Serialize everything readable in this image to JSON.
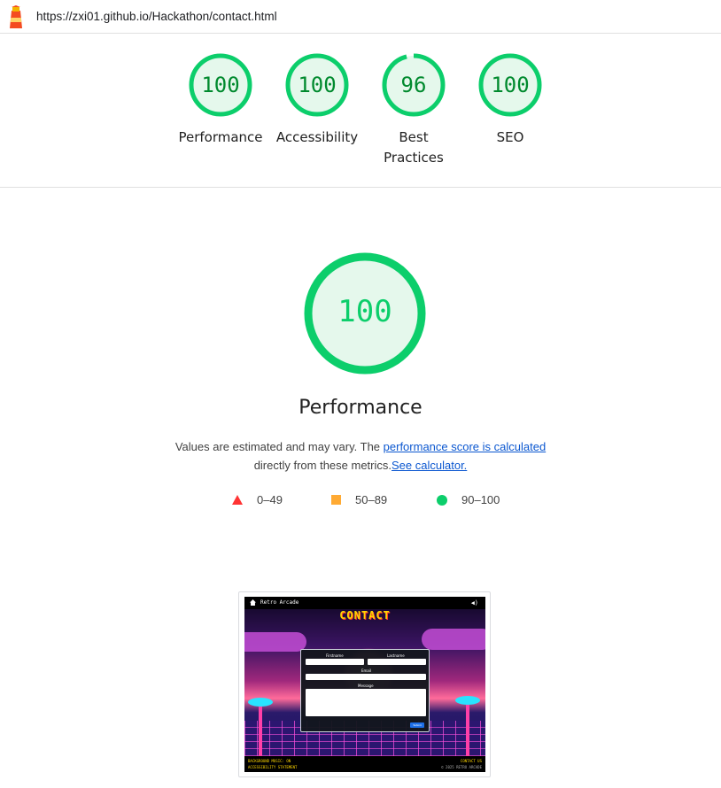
{
  "header": {
    "url": "https://zxi01.github.io/Hackathon/contact.html",
    "logo_icon": "lighthouse-logo-icon"
  },
  "summary_gauges": [
    {
      "score": "100",
      "label": "Performance"
    },
    {
      "score": "100",
      "label": "Accessibility"
    },
    {
      "score": "96",
      "label": "Best Practices"
    },
    {
      "score": "100",
      "label": "SEO"
    }
  ],
  "performance": {
    "score": "100",
    "title": "Performance",
    "desc_prefix": "Values are estimated and may vary. The ",
    "desc_link1": "performance score is calculated",
    "desc_middle": "directly from these metrics.",
    "desc_link2": "See calculator."
  },
  "legend": [
    {
      "icon": "fail-triangle-icon",
      "range": "0–49",
      "color": "#ff3333"
    },
    {
      "icon": "average-square-icon",
      "range": "50–89",
      "color": "#ffaa33"
    },
    {
      "icon": "pass-circle-icon",
      "range": "90–100",
      "color": "#0cce6b"
    }
  ],
  "screenshot": {
    "nav_title": "Retro Arcade",
    "page_title": "CONTACT",
    "speaker_icon": "speaker-icon",
    "firstname_label": "Firstname",
    "lastname_label": "Lastname",
    "email_label": "Email",
    "message_label": "Message",
    "submit_label": "Submit",
    "footer_left1": "BACKGROUND MUSIC: ON",
    "footer_left2": "ACCESSIBILITY STATEMENT",
    "footer_right1": "CONTACT US",
    "footer_right2": "© 2025 RETRO ARCADE"
  },
  "colors": {
    "pass": "#0cce6b",
    "pass_text": "#008a2e",
    "pass_fill": "#e5f8ec",
    "link": "#0b57d0"
  }
}
